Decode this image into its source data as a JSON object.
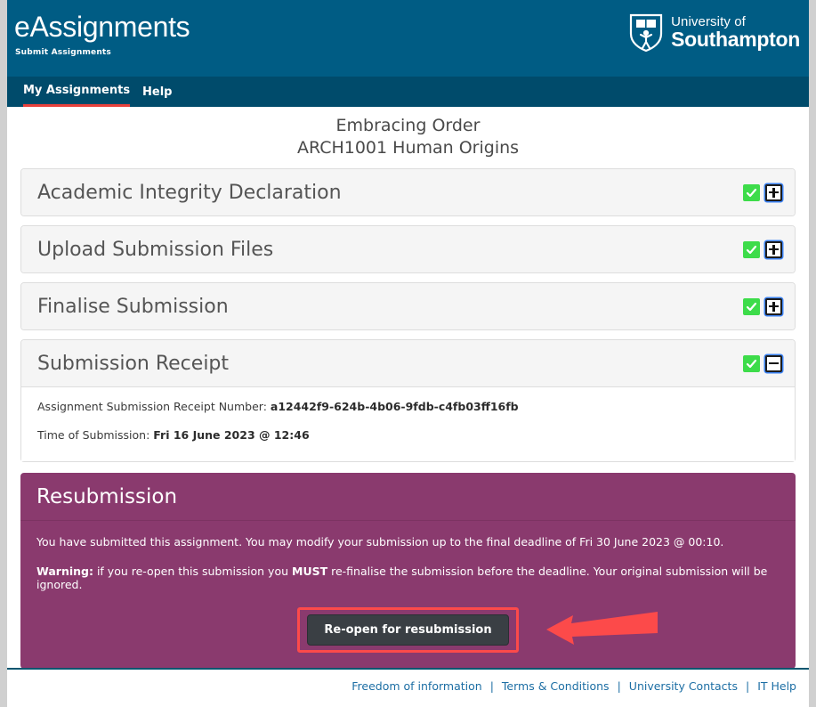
{
  "header": {
    "brand_title": "eAssignments",
    "brand_subtitle": "Submit Assignments",
    "logo": {
      "icon": "southampton-shield-crest-icon",
      "line1": "University of",
      "line2": "Southampton"
    },
    "background_color": "#005c84"
  },
  "nav": {
    "background_color": "#004b6b",
    "active_underline_color": "#e8413c",
    "items": [
      {
        "label": "My Assignments",
        "active": true
      },
      {
        "label": "Help",
        "active": false
      }
    ]
  },
  "page_title": {
    "line1": "Embracing Order",
    "line2": "ARCH1001 Human Origins"
  },
  "sections": [
    {
      "title": "Academic Integrity Declaration",
      "complete_icon": "green-check-icon",
      "toggle_icon": "plus-square-icon",
      "expanded": false
    },
    {
      "title": "Upload Submission Files",
      "complete_icon": "green-check-icon",
      "toggle_icon": "plus-square-icon",
      "expanded": false
    },
    {
      "title": "Finalise Submission",
      "complete_icon": "green-check-icon",
      "toggle_icon": "plus-square-icon",
      "expanded": false
    },
    {
      "title": "Submission Receipt",
      "complete_icon": "green-check-icon",
      "toggle_icon": "minus-square-icon",
      "expanded": true
    }
  ],
  "receipt": {
    "number_label": "Assignment Submission Receipt Number:",
    "number_value": "a12442f9-624b-4b06-9fdb-c4fb03ff16fb",
    "time_label": "Time of Submission:",
    "time_value": "Fri 16 June 2023 @ 12:46"
  },
  "resubmission": {
    "heading": "Resubmission",
    "background_color": "#8a3a6e",
    "info_text": "You have submitted this assignment. You may modify your submission up to the final deadline of Fri 30 June 2023 @ 00:10.",
    "warning_prefix": "Warning:",
    "warning_mid_1": " if you re-open this submission you ",
    "warning_strong": "MUST",
    "warning_mid_2": " re-finalise the submission before the deadline. Your original submission will be ignored.",
    "button_label": "Re-open for resubmission",
    "annotation": {
      "highlight_color": "#fc4a4a",
      "arrow_icon": "left-pointing-arrow-annotation"
    }
  },
  "footer": {
    "links": [
      "Freedom of information",
      "Terms & Conditions",
      "University Contacts",
      "IT Help"
    ],
    "separator": "|",
    "link_color": "#1c6ea4"
  }
}
